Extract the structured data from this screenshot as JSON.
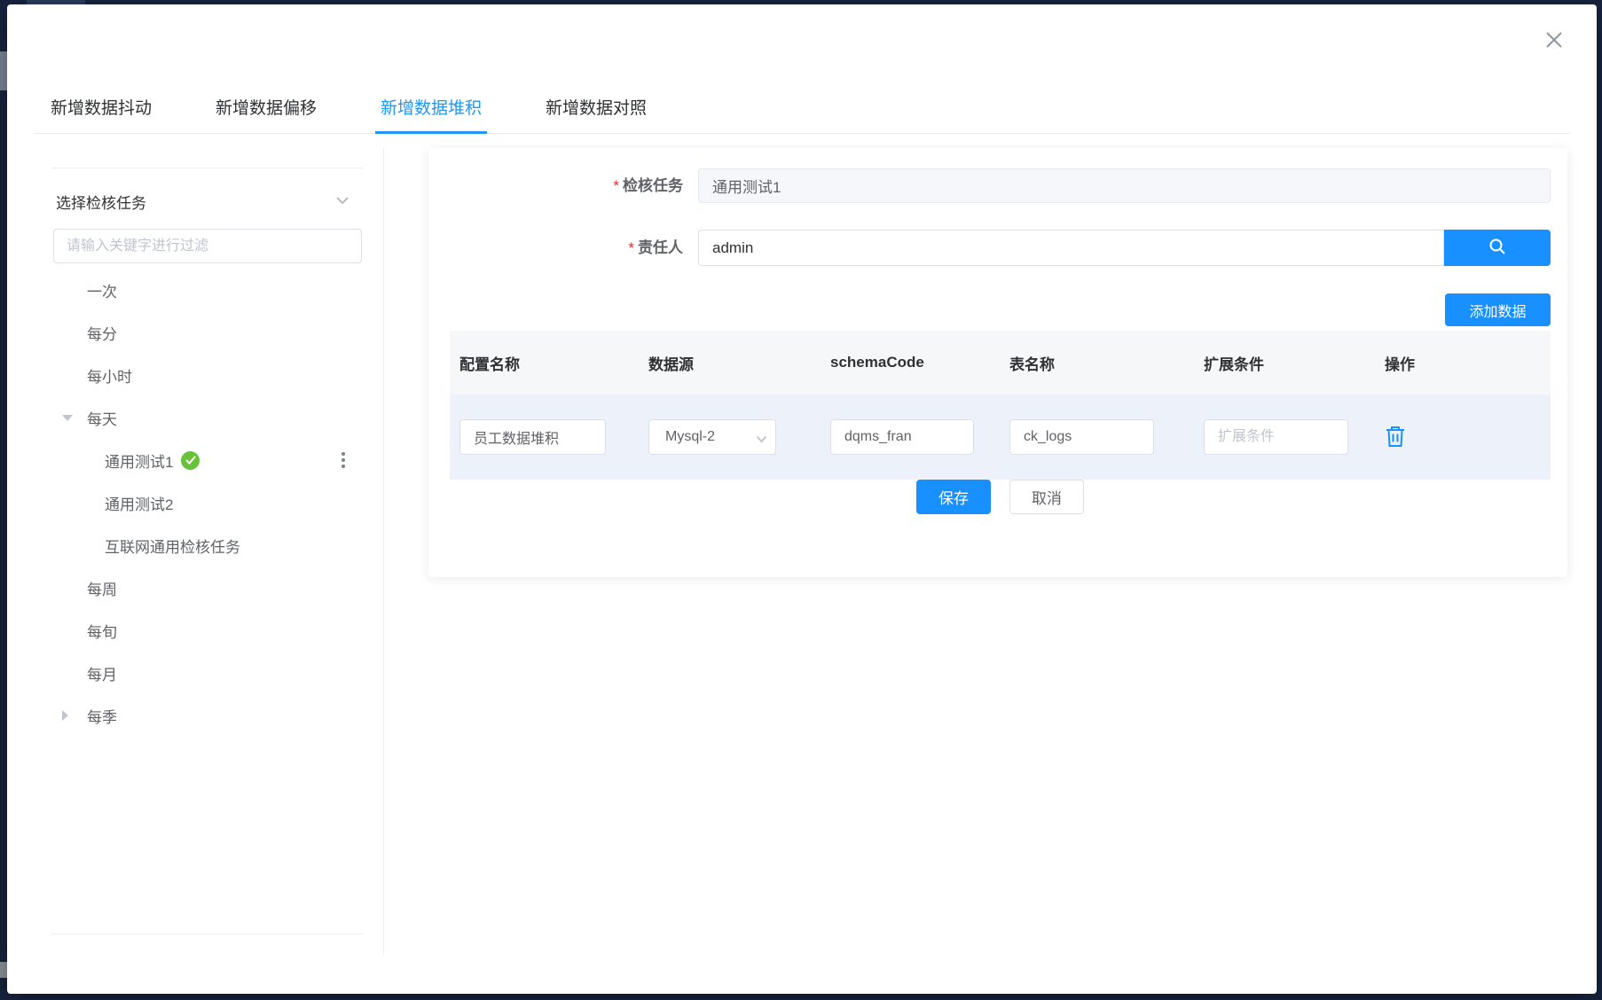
{
  "dialog": {
    "close_icon": "x"
  },
  "tabs": [
    {
      "label": "新增数据抖动",
      "active": false
    },
    {
      "label": "新增数据偏移",
      "active": false
    },
    {
      "label": "新增数据堆积",
      "active": true
    },
    {
      "label": "新增数据对照",
      "active": false
    }
  ],
  "sidebar": {
    "title": "选择检核任务",
    "filter_placeholder": "请输入关键字进行过滤",
    "tree": [
      {
        "label": "一次",
        "level": 1
      },
      {
        "label": "每分",
        "level": 1
      },
      {
        "label": "每小时",
        "level": 1
      },
      {
        "label": "每天",
        "level": 1,
        "expanded": true
      },
      {
        "label": "通用测试1",
        "level": 2,
        "selected": true
      },
      {
        "label": "通用测试2",
        "level": 2
      },
      {
        "label": "互联网通用检核任务",
        "level": 2
      },
      {
        "label": "每周",
        "level": 1
      },
      {
        "label": "每旬",
        "level": 1
      },
      {
        "label": "每月",
        "level": 1
      },
      {
        "label": "每季",
        "level": 1,
        "collapsed": true
      }
    ]
  },
  "form": {
    "task_label": "检核任务",
    "task_value": "通用测试1",
    "owner_label": "责任人",
    "owner_value": "admin",
    "add_button": "添加数据",
    "save_button": "保存",
    "cancel_button": "取消"
  },
  "table": {
    "headers": [
      "配置名称",
      "数据源",
      "schemaCode",
      "表名称",
      "扩展条件",
      "操作"
    ],
    "rows": [
      {
        "config_name": "员工数据堆积",
        "datasource": "Mysql-2",
        "schema_code": "dqms_fran",
        "table_name": "ck_logs",
        "ext_condition": "",
        "ext_placeholder": "扩展条件"
      }
    ]
  },
  "icons": {
    "close": "x-cross",
    "collapse": "chevron-down",
    "caret_expanded": "caret-down",
    "caret_collapsed": "caret-right",
    "selected_badge": "check-circle",
    "row_menu": "kebab-vertical-dots",
    "search": "magnifier",
    "delete": "trash-can",
    "select_arrow": "chevron-down"
  },
  "colors": {
    "primary": "#1890ff",
    "tab_active": "#2196f3",
    "success": "#67c23a",
    "danger_asterisk": "#f5222d",
    "backdrop": "#17243e",
    "row_highlight": "#edf1f9"
  }
}
